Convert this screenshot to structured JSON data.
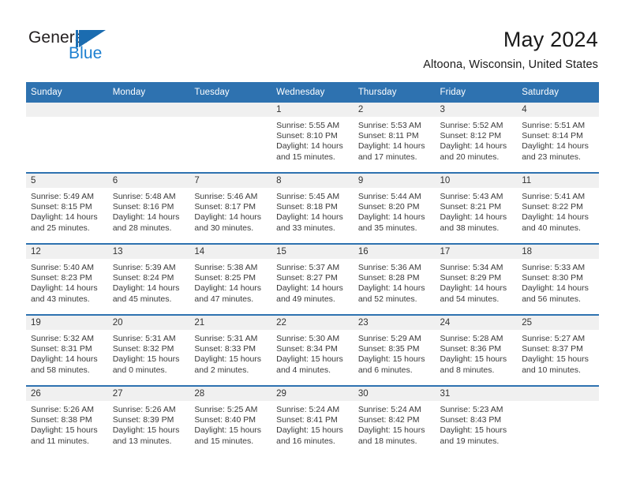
{
  "brand": {
    "name_part1": "General",
    "name_part2": "Blue",
    "logo_icon": "general-blue-flag-icon"
  },
  "header": {
    "month_title": "May 2024",
    "location": "Altoona, Wisconsin, United States"
  },
  "theme": {
    "header_blue": "#2e72b0",
    "brand_blue": "#1c7fd0",
    "daynum_band": "#f0f0f0",
    "text": "#3a3a3a"
  },
  "weekday_headers": [
    "Sunday",
    "Monday",
    "Tuesday",
    "Wednesday",
    "Thursday",
    "Friday",
    "Saturday"
  ],
  "labels": {
    "sunrise_prefix": "Sunrise:",
    "sunset_prefix": "Sunset:",
    "daylight_prefix": "Daylight:"
  },
  "weeks": [
    [
      {
        "day": "",
        "empty": true
      },
      {
        "day": "",
        "empty": true
      },
      {
        "day": "",
        "empty": true
      },
      {
        "day": "1",
        "sunrise": "Sunrise: 5:55 AM",
        "sunset": "Sunset: 8:10 PM",
        "daylight_line1": "Daylight: 14 hours",
        "daylight_line2": "and 15 minutes."
      },
      {
        "day": "2",
        "sunrise": "Sunrise: 5:53 AM",
        "sunset": "Sunset: 8:11 PM",
        "daylight_line1": "Daylight: 14 hours",
        "daylight_line2": "and 17 minutes."
      },
      {
        "day": "3",
        "sunrise": "Sunrise: 5:52 AM",
        "sunset": "Sunset: 8:12 PM",
        "daylight_line1": "Daylight: 14 hours",
        "daylight_line2": "and 20 minutes."
      },
      {
        "day": "4",
        "sunrise": "Sunrise: 5:51 AM",
        "sunset": "Sunset: 8:14 PM",
        "daylight_line1": "Daylight: 14 hours",
        "daylight_line2": "and 23 minutes."
      }
    ],
    [
      {
        "day": "5",
        "sunrise": "Sunrise: 5:49 AM",
        "sunset": "Sunset: 8:15 PM",
        "daylight_line1": "Daylight: 14 hours",
        "daylight_line2": "and 25 minutes."
      },
      {
        "day": "6",
        "sunrise": "Sunrise: 5:48 AM",
        "sunset": "Sunset: 8:16 PM",
        "daylight_line1": "Daylight: 14 hours",
        "daylight_line2": "and 28 minutes."
      },
      {
        "day": "7",
        "sunrise": "Sunrise: 5:46 AM",
        "sunset": "Sunset: 8:17 PM",
        "daylight_line1": "Daylight: 14 hours",
        "daylight_line2": "and 30 minutes."
      },
      {
        "day": "8",
        "sunrise": "Sunrise: 5:45 AM",
        "sunset": "Sunset: 8:18 PM",
        "daylight_line1": "Daylight: 14 hours",
        "daylight_line2": "and 33 minutes."
      },
      {
        "day": "9",
        "sunrise": "Sunrise: 5:44 AM",
        "sunset": "Sunset: 8:20 PM",
        "daylight_line1": "Daylight: 14 hours",
        "daylight_line2": "and 35 minutes."
      },
      {
        "day": "10",
        "sunrise": "Sunrise: 5:43 AM",
        "sunset": "Sunset: 8:21 PM",
        "daylight_line1": "Daylight: 14 hours",
        "daylight_line2": "and 38 minutes."
      },
      {
        "day": "11",
        "sunrise": "Sunrise: 5:41 AM",
        "sunset": "Sunset: 8:22 PM",
        "daylight_line1": "Daylight: 14 hours",
        "daylight_line2": "and 40 minutes."
      }
    ],
    [
      {
        "day": "12",
        "sunrise": "Sunrise: 5:40 AM",
        "sunset": "Sunset: 8:23 PM",
        "daylight_line1": "Daylight: 14 hours",
        "daylight_line2": "and 43 minutes."
      },
      {
        "day": "13",
        "sunrise": "Sunrise: 5:39 AM",
        "sunset": "Sunset: 8:24 PM",
        "daylight_line1": "Daylight: 14 hours",
        "daylight_line2": "and 45 minutes."
      },
      {
        "day": "14",
        "sunrise": "Sunrise: 5:38 AM",
        "sunset": "Sunset: 8:25 PM",
        "daylight_line1": "Daylight: 14 hours",
        "daylight_line2": "and 47 minutes."
      },
      {
        "day": "15",
        "sunrise": "Sunrise: 5:37 AM",
        "sunset": "Sunset: 8:27 PM",
        "daylight_line1": "Daylight: 14 hours",
        "daylight_line2": "and 49 minutes."
      },
      {
        "day": "16",
        "sunrise": "Sunrise: 5:36 AM",
        "sunset": "Sunset: 8:28 PM",
        "daylight_line1": "Daylight: 14 hours",
        "daylight_line2": "and 52 minutes."
      },
      {
        "day": "17",
        "sunrise": "Sunrise: 5:34 AM",
        "sunset": "Sunset: 8:29 PM",
        "daylight_line1": "Daylight: 14 hours",
        "daylight_line2": "and 54 minutes."
      },
      {
        "day": "18",
        "sunrise": "Sunrise: 5:33 AM",
        "sunset": "Sunset: 8:30 PM",
        "daylight_line1": "Daylight: 14 hours",
        "daylight_line2": "and 56 minutes."
      }
    ],
    [
      {
        "day": "19",
        "sunrise": "Sunrise: 5:32 AM",
        "sunset": "Sunset: 8:31 PM",
        "daylight_line1": "Daylight: 14 hours",
        "daylight_line2": "and 58 minutes."
      },
      {
        "day": "20",
        "sunrise": "Sunrise: 5:31 AM",
        "sunset": "Sunset: 8:32 PM",
        "daylight_line1": "Daylight: 15 hours",
        "daylight_line2": "and 0 minutes."
      },
      {
        "day": "21",
        "sunrise": "Sunrise: 5:31 AM",
        "sunset": "Sunset: 8:33 PM",
        "daylight_line1": "Daylight: 15 hours",
        "daylight_line2": "and 2 minutes."
      },
      {
        "day": "22",
        "sunrise": "Sunrise: 5:30 AM",
        "sunset": "Sunset: 8:34 PM",
        "daylight_line1": "Daylight: 15 hours",
        "daylight_line2": "and 4 minutes."
      },
      {
        "day": "23",
        "sunrise": "Sunrise: 5:29 AM",
        "sunset": "Sunset: 8:35 PM",
        "daylight_line1": "Daylight: 15 hours",
        "daylight_line2": "and 6 minutes."
      },
      {
        "day": "24",
        "sunrise": "Sunrise: 5:28 AM",
        "sunset": "Sunset: 8:36 PM",
        "daylight_line1": "Daylight: 15 hours",
        "daylight_line2": "and 8 minutes."
      },
      {
        "day": "25",
        "sunrise": "Sunrise: 5:27 AM",
        "sunset": "Sunset: 8:37 PM",
        "daylight_line1": "Daylight: 15 hours",
        "daylight_line2": "and 10 minutes."
      }
    ],
    [
      {
        "day": "26",
        "sunrise": "Sunrise: 5:26 AM",
        "sunset": "Sunset: 8:38 PM",
        "daylight_line1": "Daylight: 15 hours",
        "daylight_line2": "and 11 minutes."
      },
      {
        "day": "27",
        "sunrise": "Sunrise: 5:26 AM",
        "sunset": "Sunset: 8:39 PM",
        "daylight_line1": "Daylight: 15 hours",
        "daylight_line2": "and 13 minutes."
      },
      {
        "day": "28",
        "sunrise": "Sunrise: 5:25 AM",
        "sunset": "Sunset: 8:40 PM",
        "daylight_line1": "Daylight: 15 hours",
        "daylight_line2": "and 15 minutes."
      },
      {
        "day": "29",
        "sunrise": "Sunrise: 5:24 AM",
        "sunset": "Sunset: 8:41 PM",
        "daylight_line1": "Daylight: 15 hours",
        "daylight_line2": "and 16 minutes."
      },
      {
        "day": "30",
        "sunrise": "Sunrise: 5:24 AM",
        "sunset": "Sunset: 8:42 PM",
        "daylight_line1": "Daylight: 15 hours",
        "daylight_line2": "and 18 minutes."
      },
      {
        "day": "31",
        "sunrise": "Sunrise: 5:23 AM",
        "sunset": "Sunset: 8:43 PM",
        "daylight_line1": "Daylight: 15 hours",
        "daylight_line2": "and 19 minutes."
      },
      {
        "day": "",
        "empty": true
      }
    ]
  ]
}
